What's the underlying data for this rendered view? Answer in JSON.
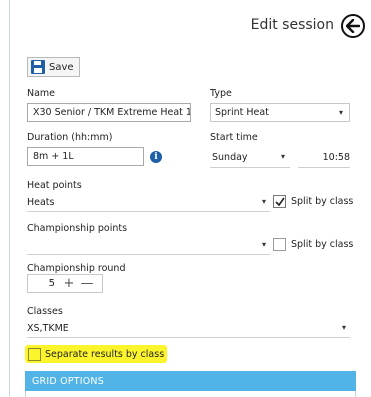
{
  "header": {
    "title": "Edit session",
    "back_icon": "arrow-left-icon"
  },
  "toolbar": {
    "save_label": "Save",
    "save_icon": "floppy-disk-icon",
    "save_icon_color": "#1f5fa8"
  },
  "form": {
    "name": {
      "label": "Name",
      "value": "X30 Senior / TKM Extreme Heat 1"
    },
    "type": {
      "label": "Type",
      "value": "Sprint Heat"
    },
    "duration": {
      "label": "Duration (hh:mm)",
      "value": "8m + 1L",
      "info_icon": "info-icon"
    },
    "start_time": {
      "label": "Start time",
      "day": "Sunday",
      "time": "10:58"
    },
    "heat_points": {
      "label": "Heat points",
      "value": "Heats",
      "split_label": "Split by class",
      "split_checked": true
    },
    "championship_points": {
      "label": "Championship points",
      "value": "",
      "split_label": "Split by class",
      "split_checked": false
    },
    "championship_round": {
      "label": "Championship round",
      "value": "5",
      "plus": "+",
      "minus": "—"
    },
    "classes": {
      "label": "Classes",
      "value": "XS,TKME"
    },
    "separate_results": {
      "label": "Separate results by class",
      "checked": false,
      "highlight_color": "#fdf52b"
    }
  },
  "grid_options": {
    "title": "GRID OPTIONS",
    "color": "#52b4e6"
  }
}
